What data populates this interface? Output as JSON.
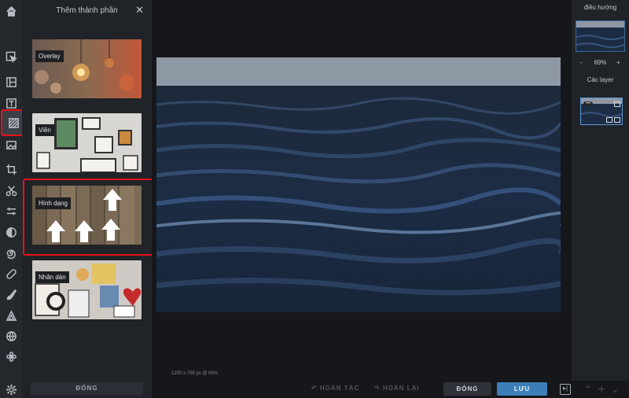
{
  "panel": {
    "title": "Thêm thành phần",
    "close_icon": "✕",
    "cards": [
      {
        "label": "Overlay",
        "icon": "bokeh-bulbs"
      },
      {
        "label": "Viền",
        "icon": "picture-frames"
      },
      {
        "label": "Hình dạng",
        "icon": "wood-arrows"
      },
      {
        "label": "Nhãn dán",
        "icon": "stickers"
      }
    ],
    "close_button": "ĐÓNG"
  },
  "toolbar": {
    "tools": [
      "home-icon",
      "select-icon",
      "layout-icon",
      "text-icon",
      "add-element-icon",
      "image-icon",
      "crop-icon",
      "cut-icon",
      "adjust-icon",
      "filter-icon",
      "swirl-icon",
      "bandage-icon",
      "brush-icon",
      "triangle-icon",
      "globe-icon",
      "flower-icon",
      "settings-icon"
    ]
  },
  "canvas": {
    "size_info": "1200 x 758 px @ 69%"
  },
  "bottombar": {
    "undo": "↶ HOÀN TÁC",
    "redo": "↷ HOÀN LẠI",
    "close": "ĐÓNG",
    "save": "LƯU",
    "toggle_icon": "▸|"
  },
  "right": {
    "nav_title": "điều hướng",
    "zoom": {
      "minus": "-",
      "value": "69%",
      "plus": "+"
    },
    "layers_title": "Các layer",
    "layer_badge": "•••"
  },
  "colors": {
    "highlight": "#e8101a",
    "accent": "#3c7fb8",
    "sea_dark": "#152438",
    "sky": "#8f98a5"
  }
}
